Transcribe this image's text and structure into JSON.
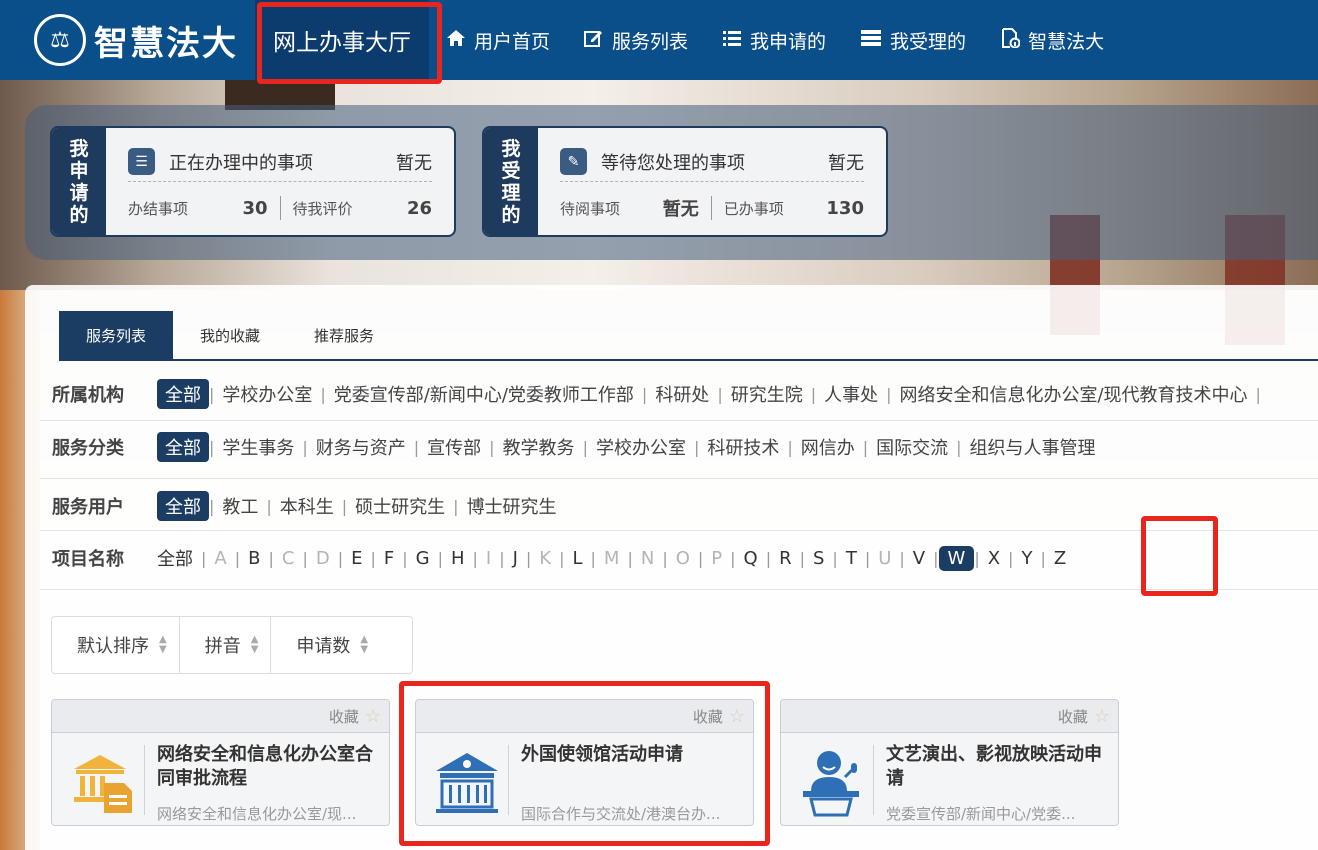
{
  "header": {
    "logo_text": "智慧法大",
    "nav": [
      {
        "label": "网上办事大厅",
        "icon": ""
      },
      {
        "label": "用户首页",
        "icon": "home-icon"
      },
      {
        "label": "服务列表",
        "icon": "edit-icon"
      },
      {
        "label": "我申请的",
        "icon": "list-icon"
      },
      {
        "label": "我受理的",
        "icon": "stack-icon"
      },
      {
        "label": "智慧法大",
        "icon": "info-doc-icon"
      }
    ]
  },
  "stats": {
    "applied": {
      "vertical_label": [
        "我",
        "申",
        "请",
        "的"
      ],
      "title": "正在办理中的事项",
      "title_value": "暂无",
      "a_label": "办结事项",
      "a_value": "30",
      "b_label": "待我评价",
      "b_value": "26"
    },
    "received": {
      "vertical_label": [
        "我",
        "受",
        "理",
        "的"
      ],
      "title": "等待您处理的事项",
      "title_value": "暂无",
      "a_label": "待阅事项",
      "a_value": "暂无",
      "b_label": "已办事项",
      "b_value": "130"
    }
  },
  "tabs": [
    "服务列表",
    "我的收藏",
    "推荐服务"
  ],
  "filters": {
    "org": {
      "label": "所属机构",
      "options": [
        "全部",
        "学校办公室",
        "党委宣传部/新闻中心/党委教师工作部",
        "科研处",
        "研究生院",
        "人事处",
        "网络安全和信息化办公室/现代教育技术中心"
      ]
    },
    "category": {
      "label": "服务分类",
      "options": [
        "全部",
        "学生事务",
        "财务与资产",
        "宣传部",
        "教学教务",
        "学校办公室",
        "科研技术",
        "网信办",
        "国际交流",
        "组织与人事管理"
      ]
    },
    "user": {
      "label": "服务用户",
      "options": [
        "全部",
        "教工",
        "本科生",
        "硕士研究生",
        "博士研究生"
      ]
    },
    "name": {
      "label": "项目名称",
      "all": "全部",
      "letters": [
        "A",
        "B",
        "C",
        "D",
        "E",
        "F",
        "G",
        "H",
        "I",
        "J",
        "K",
        "L",
        "M",
        "N",
        "O",
        "P",
        "Q",
        "R",
        "S",
        "T",
        "U",
        "V",
        "W",
        "X",
        "Y",
        "Z"
      ],
      "selected": "W"
    }
  },
  "sort": [
    "默认排序",
    "拼音",
    "申请数"
  ],
  "cards": [
    {
      "fav": "收藏",
      "title": "网络安全和信息化办公室合同审批流程",
      "sub": "网络安全和信息化办公室/现...",
      "icon": "bank-document-icon"
    },
    {
      "fav": "收藏",
      "title": "外国使领馆活动申请",
      "sub": "国际合作与交流处/港澳台办...",
      "icon": "embassy-building-icon"
    },
    {
      "fav": "收藏",
      "title": "文艺演出、影视放映活动申请",
      "sub": "党委宣传部/新闻中心/党委...",
      "icon": "speaker-podium-icon"
    }
  ],
  "colors": {
    "nav_bg": "#0b4f8a",
    "accent_dark": "#1b3d63",
    "highlight": "#e8261e"
  }
}
